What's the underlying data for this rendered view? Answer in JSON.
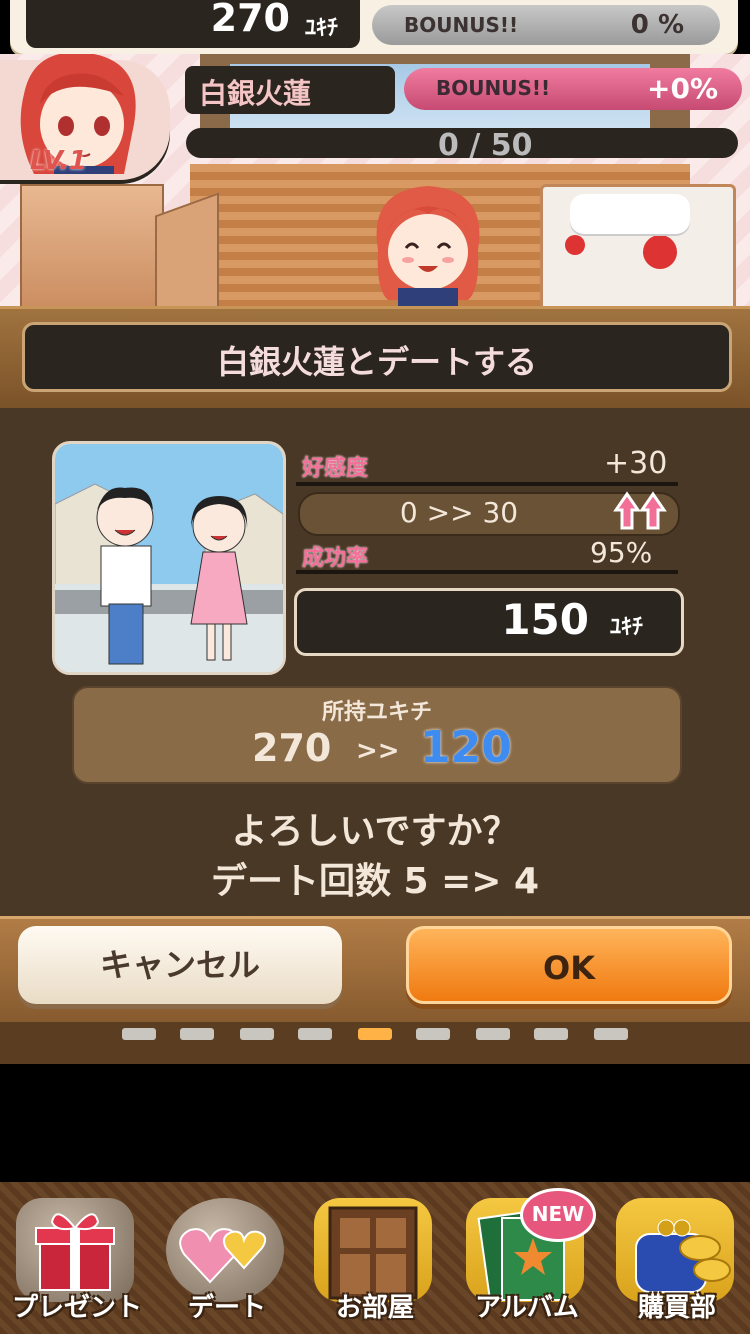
{
  "hud": {
    "money_value": "270",
    "money_unit": "ﾕｷﾁ",
    "bonus_label": "BOUNUS!!",
    "bonus_value": "0 %"
  },
  "character": {
    "name": "白銀火蓮",
    "bonus_label": "BOUNUS!!",
    "bonus_value": "+0%",
    "exp_text": "0 / 50",
    "level": "LV.1"
  },
  "dialog": {
    "title": "白銀火蓮とデートする",
    "affinity_label": "好感度",
    "affinity_gain": "+30",
    "affinity_range": "0 >> 30",
    "success_label": "成功率",
    "success_value": "95%",
    "cost_value": "150",
    "cost_unit": "ﾕｷﾁ",
    "wallet_label": "所持ユキチ",
    "wallet_from": "270",
    "wallet_arrow": ">>",
    "wallet_to": "120",
    "confirm_line1": "よろしいですか？",
    "confirm_line2": "デート回数 5 => 4",
    "cancel_label": "キャンセル",
    "ok_label": "OK"
  },
  "nav": {
    "items": [
      {
        "label": "プレゼント",
        "icon": "gift-icon"
      },
      {
        "label": "デート",
        "icon": "hearts-icon"
      },
      {
        "label": "お部屋",
        "icon": "door-icon"
      },
      {
        "label": "アルバム",
        "icon": "album-icon",
        "badge": "NEW"
      },
      {
        "label": "購買部",
        "icon": "coin-purse-icon"
      }
    ]
  },
  "colors": {
    "accent_pink": "#f26f98",
    "ok_orange": "#f07a10",
    "wallet_blue": "#3f8cf0",
    "panel_brown": "#4a3826"
  }
}
